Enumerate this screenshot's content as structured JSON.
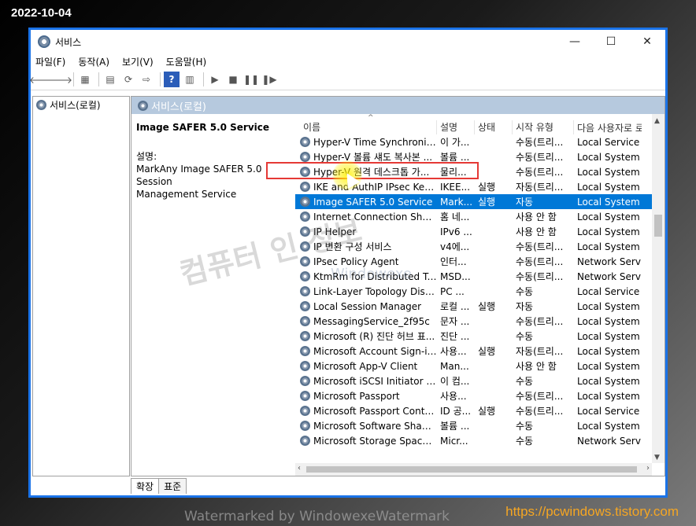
{
  "overlay": {
    "date": "2022-10-04",
    "url": "https://pcwindows.tistory.com"
  },
  "window": {
    "title": "서비스",
    "minimize": "—",
    "maximize": "☐",
    "close": "✕"
  },
  "menu": [
    "파일(F)",
    "동작(A)",
    "보기(V)",
    "도움말(H)"
  ],
  "toolbar_icons": [
    "back-arrow-icon",
    "forward-arrow-icon",
    "console-tree-icon",
    "properties-icon",
    "refresh-icon",
    "export-icon",
    "help-icon",
    "view-icon",
    "play-icon",
    "stop-icon",
    "pause-icon",
    "restart-icon"
  ],
  "tree": {
    "root": "서비스(로컬)"
  },
  "panel": {
    "header": "서비스(로컬)"
  },
  "details": {
    "service_name": "Image SAFER 5.0 Service",
    "desc_label": "설명:",
    "desc_line1": "MarkAny Image SAFER 5.0 Session",
    "desc_line2": "Management Service"
  },
  "columns": {
    "name": "이름",
    "desc": "설명",
    "status": "상태",
    "startup": "시작 유형",
    "logon": "다음 사용자로 로"
  },
  "rows": [
    [
      "Hyper-V Time Synchroniza...",
      "이 가...",
      "",
      "수동(트리...",
      "Local Service"
    ],
    [
      "Hyper-V 볼륨 섀도 복사본 ...",
      "볼륨 ...",
      "",
      "수동(트리...",
      "Local System"
    ],
    [
      "Hyper-V 원격 데스크톱 가...",
      "물리...",
      "",
      "수동(트리...",
      "Local System"
    ],
    [
      "IKE and AuthIP IPsec Keyin...",
      "IKEE...",
      "실행",
      "자동(트리...",
      "Local System"
    ],
    [
      "Image SAFER 5.0 Service",
      "Mark...",
      "실행",
      "자동",
      "Local System"
    ],
    [
      "Internet Connection Sharin...",
      "홈 네...",
      "",
      "사용 안 함",
      "Local System"
    ],
    [
      "IP Helper",
      "IPv6 ...",
      "",
      "사용 안 함",
      "Local System"
    ],
    [
      "IP 변환 구성 서비스",
      "v4에...",
      "",
      "수동(트리...",
      "Local System"
    ],
    [
      "IPsec Policy Agent",
      "인터...",
      "",
      "수동(트리...",
      "Network Service"
    ],
    [
      "KtmRm for Distributed Tra...",
      "MSD...",
      "",
      "수동(트리...",
      "Network Service"
    ],
    [
      "Link-Layer Topology Disco...",
      "PC ...",
      "",
      "수동",
      "Local Service"
    ],
    [
      "Local Session Manager",
      "로컬 ...",
      "실행",
      "자동",
      "Local System"
    ],
    [
      "MessagingService_2f95c",
      "문자 ...",
      "",
      "수동(트리...",
      "Local System"
    ],
    [
      "Microsoft (R) 진단 허브 표...",
      "진단 ...",
      "",
      "수동",
      "Local System"
    ],
    [
      "Microsoft Account Sign-in ...",
      "사용...",
      "실행",
      "자동(트리...",
      "Local System"
    ],
    [
      "Microsoft App-V Client",
      "Man...",
      "",
      "사용 안 함",
      "Local System"
    ],
    [
      "Microsoft iSCSI Initiator Se...",
      "이 컴...",
      "",
      "수동",
      "Local System"
    ],
    [
      "Microsoft Passport",
      "사용...",
      "",
      "수동(트리...",
      "Local System"
    ],
    [
      "Microsoft Passport Container",
      "ID 공...",
      "실행",
      "수동(트리...",
      "Local Service"
    ],
    [
      "Microsoft Software Shado...",
      "볼륨 ...",
      "",
      "수동",
      "Local System"
    ],
    [
      "Microsoft Storage Spaces ...",
      "Micr...",
      "",
      "수동",
      "Network Service"
    ]
  ],
  "selected_index": 4,
  "tabs": [
    "확장",
    "표준"
  ],
  "watermarks": {
    "korean": "컴퓨터 인 정보",
    "middle": "Windowexe",
    "bottom": "Watermarked by WindowexeWatermark"
  },
  "colors": {
    "accent": "#1a73e8",
    "selection": "#0078d7",
    "highlight_box": "#e53935",
    "url": "#f5a623"
  }
}
